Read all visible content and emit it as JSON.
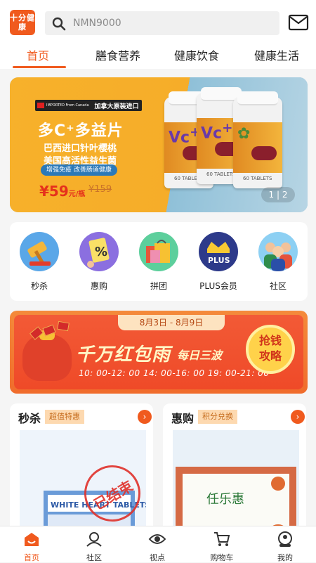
{
  "header": {
    "logo_text": "十分健康",
    "search_placeholder": "NMN9000"
  },
  "tabs": [
    {
      "label": "首页",
      "active": true
    },
    {
      "label": "膳食营养",
      "active": false
    },
    {
      "label": "健康饮食",
      "active": false
    },
    {
      "label": "健康生活",
      "active": false
    }
  ],
  "banner": {
    "badge_small": "IMPORTED From Canada",
    "badge_label": "加拿大原装进口",
    "title": "多C⁺多益片",
    "line1": "巴西进口针叶樱桃",
    "line2": "美国高活性益生菌",
    "pill": "增强免疫 改善肠道健康",
    "price": "¥59",
    "price_unit": "元/瓶",
    "old_price": "¥159",
    "bottle_count_text": "60 TABLETS",
    "page_current": "1",
    "page_total": "2"
  },
  "quick_entries": [
    {
      "label": "秒杀",
      "icon": "hammer-icon"
    },
    {
      "label": "惠购",
      "icon": "percent-coupon-icon"
    },
    {
      "label": "拼团",
      "icon": "shopping-bags-icon"
    },
    {
      "label": "PLUS会员",
      "icon": "plus-crown-icon"
    },
    {
      "label": "社区",
      "icon": "people-community-icon"
    }
  ],
  "promo": {
    "date_range": "8月3日 - 8月9日",
    "headline": "千万红包雨",
    "headline_sub": "每日三波",
    "times": "10: 00-12: 00   14: 00-16: 00   19: 00-21: 00",
    "button_line1": "抢钱",
    "button_line2": "攻略"
  },
  "cards": [
    {
      "title": "秒杀",
      "tag": "超值特惠",
      "stamp": "已结束",
      "product_text": "WHITE HEART TABLETS"
    },
    {
      "title": "惠购",
      "tag": "积分兑换",
      "product_text": "任乐惠"
    }
  ],
  "tabbar": [
    {
      "label": "首页",
      "active": true
    },
    {
      "label": "社区",
      "active": false
    },
    {
      "label": "视点",
      "active": false
    },
    {
      "label": "购物车",
      "active": false
    },
    {
      "label": "我的",
      "active": false
    }
  ],
  "colors": {
    "accent": "#f05a1e",
    "banner_yellow": "#f7b12b",
    "promo_red": "#ef4a28"
  }
}
